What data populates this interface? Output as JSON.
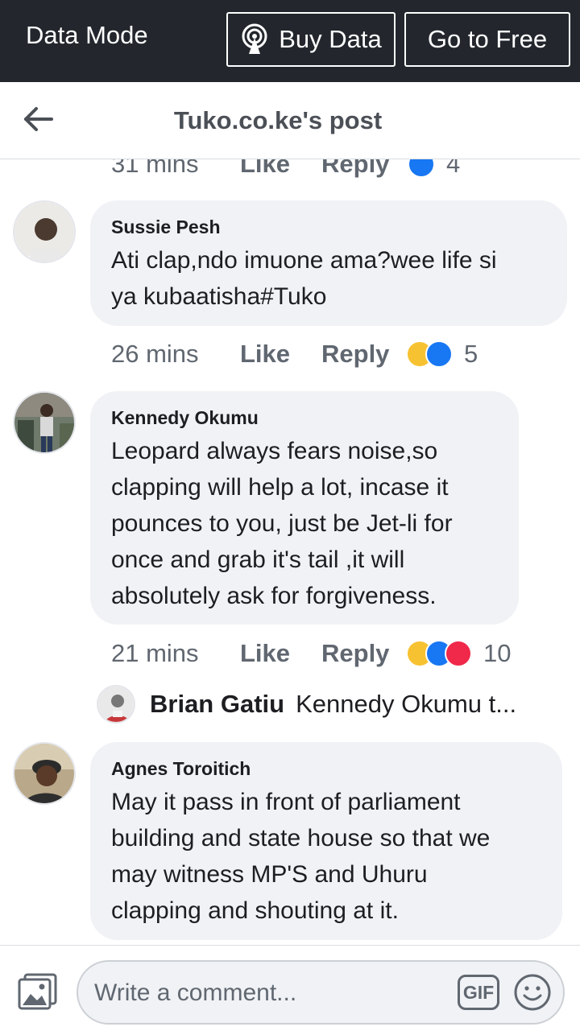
{
  "topbar": {
    "mode_label": "Data Mode",
    "buy_label": "Buy Data",
    "free_label": "Go to Free"
  },
  "header": {
    "title": "Tuko.co.ke's post"
  },
  "partial_meta": {
    "time": "31 mins",
    "like": "Like",
    "reply": "Reply",
    "count": "4"
  },
  "comments": [
    {
      "name": "Sussie Pesh",
      "lines": [
        "Ati clap,ndo imuone ama?wee life si",
        "ya kubaatisha#Tuko"
      ],
      "time": "26 mins",
      "like": "Like",
      "reply": "Reply",
      "count": "5"
    },
    {
      "name": "Kennedy Okumu",
      "lines": [
        "Leopard always fears noise,so",
        "clapping will help a lot, incase it",
        "pounces to you, just be Jet-li for",
        "once and grab it's tail ,it will",
        "absolutely ask for forgiveness."
      ],
      "time": "21 mins",
      "like": "Like",
      "reply": "Reply",
      "count": "10"
    },
    {
      "name": "Agnes Toroitich",
      "lines": [
        "May it pass in front of parliament",
        "building and state house so that we",
        "may witness MP'S and Uhuru",
        "clapping and shouting at it."
      ]
    }
  ],
  "reply_preview": {
    "name": "Brian Gatiu",
    "text": "Kennedy Okumu t..."
  },
  "composer": {
    "placeholder": "Write a comment...",
    "gif_label": "GIF"
  },
  "colors": {
    "topbar_bg": "#23272d",
    "bubble_bg": "#f0f2f5",
    "like_blue": "#1877f2",
    "haha_yellow": "#f7c232",
    "love_red": "#f02849"
  }
}
